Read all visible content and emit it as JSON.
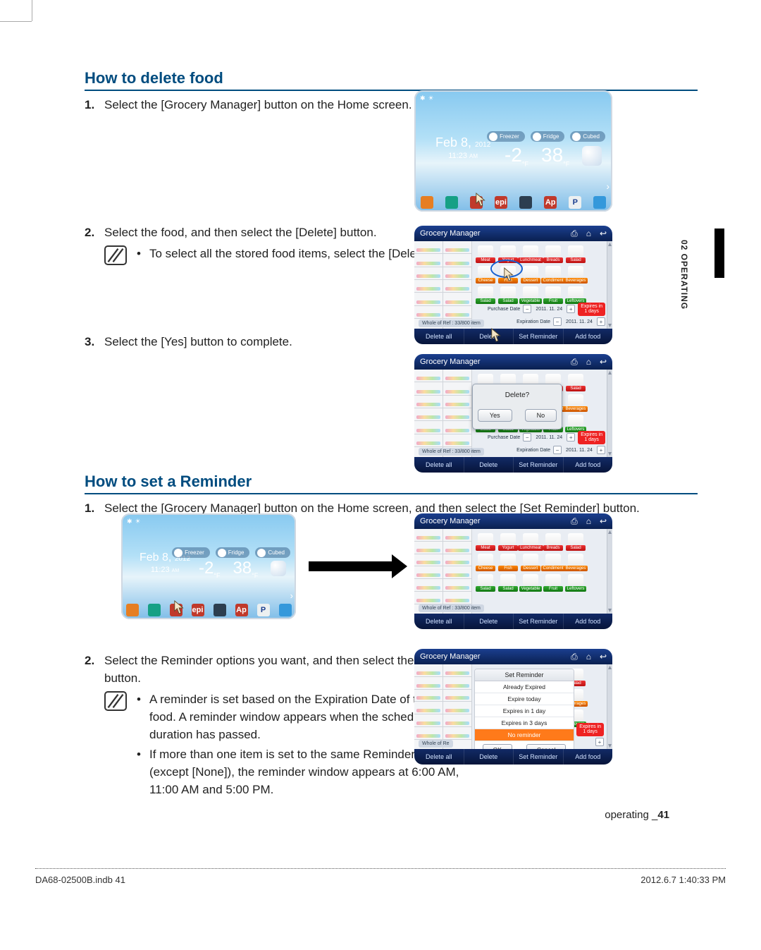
{
  "tab": "02  OPERATING",
  "section1": {
    "title": "How to delete food",
    "step1": "Select the [Grocery Manager] button on the Home screen.",
    "step2": "Select the food, and then select the [Delete] button.",
    "note2": "To select all the stored food items, select the [Delete all] button.",
    "step3": "Select the [Yes] button to complete."
  },
  "section2": {
    "title": "How to set a Reminder",
    "step1": "Select the [Grocery Manager] button on the Home screen, and then select the [Set Reminder] button.",
    "step2": "Select the Reminder options you want, and then select the [OK] button.",
    "note2a": "A reminder is set based on the Expiration Date of the stored food. A reminder window appears when the scheduled duration has passed.",
    "note2b": "If more than one item is set to the same Reminder value (except [None]), the reminder window appears at 6:00 AM, 11:00 AM and 5:00 PM."
  },
  "home": {
    "date": "Feb 8,",
    "year": "2012",
    "time": "11:23",
    "ampm": "AM",
    "freezer": "-2",
    "fridge": "38",
    "unit": "°F",
    "pills": [
      "Freezer",
      "Fridge",
      "Cubed"
    ],
    "dock": [
      "Memo",
      "Photos",
      "GroceryMg",
      "Epicurious",
      "Calendar",
      "AP News",
      "Pandora",
      "Twitter"
    ],
    "dock_letters": [
      "",
      "",
      "",
      "epi",
      "",
      "Ap",
      "P",
      ""
    ]
  },
  "gm": {
    "title": "Grocery Manager",
    "strip": "Whole of Ref : 33/800 item",
    "purchase_lbl": "Purchase Date",
    "expire_lbl": "Expiration Date",
    "date1": "2011. 11. 24",
    "date2": "2011. 11. 24",
    "badge1": "Expires in",
    "badge2": "1 days",
    "buttons": [
      "Delete all",
      "Delete",
      "Set Reminder",
      "Add food"
    ],
    "cats1": [
      "Meat",
      "Yogurt",
      "Lunchmeat",
      "Breads",
      "Salad"
    ],
    "cats2": [
      "Cheese",
      "Fish",
      "Dessert",
      "Condiment",
      "Beverages"
    ],
    "cats3": [
      "Salad",
      "Salad",
      "Vegetable",
      "Fruit",
      "Leftovers"
    ]
  },
  "dialog": {
    "q": "Delete?",
    "yes": "Yes",
    "no": "No"
  },
  "reminder": {
    "title": "Set Reminder",
    "opts": [
      "Already Expired",
      "Expire today",
      "Expires in 1 day",
      "Expires in 3 days",
      "No reminder"
    ],
    "ok": "OK",
    "cancel": "Cancel"
  },
  "footer": {
    "label": "operating _",
    "page": "41"
  },
  "print": {
    "file": "DA68-02500B.indb   41",
    "stamp": "2012.6.7   1:40:33 PM"
  }
}
